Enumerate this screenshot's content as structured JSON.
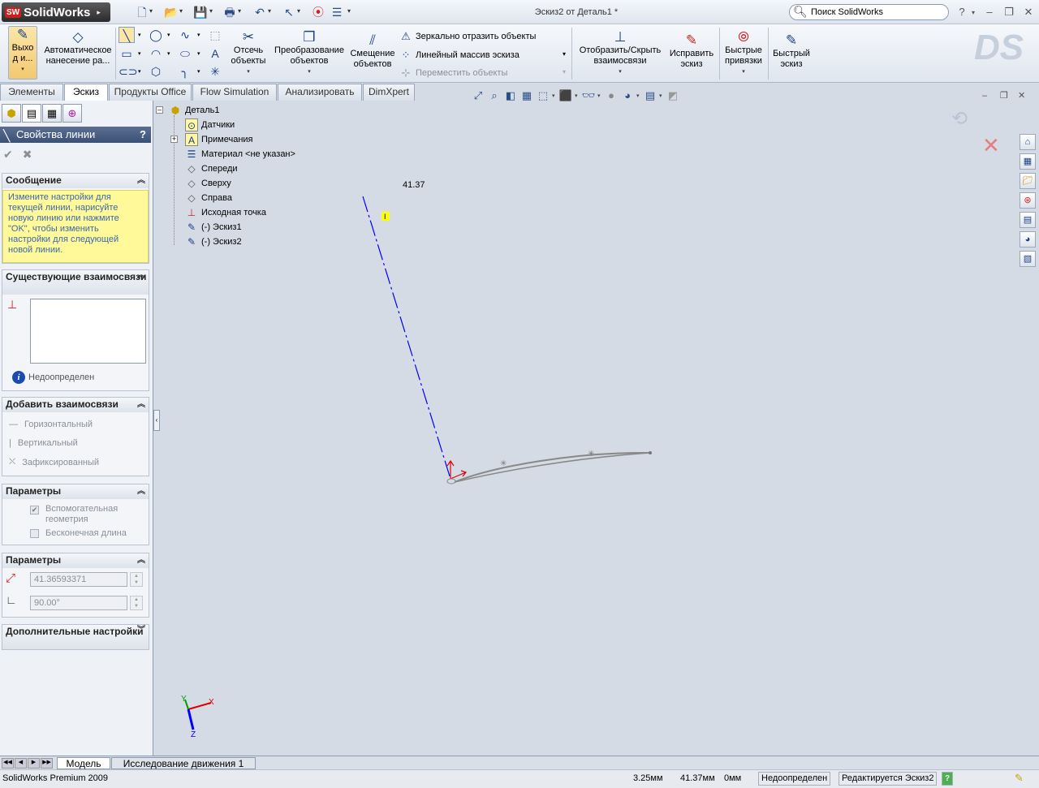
{
  "app": {
    "logo": "SolidWorks",
    "logo_badge": "SW",
    "window_title": "Эскиз2 от Деталь1 *",
    "search_placeholder": "Поиск SolidWorks"
  },
  "ribbon": {
    "exit_sketch": "Выхо\nд и...",
    "auto_dimension": "Автоматическое\nнанесение ра...",
    "trim": "Отсечь\nобъекты",
    "convert": "Преобразование\nобъектов",
    "offset": "Смещение\nобъектов",
    "mirror": "Зеркально отразить объекты",
    "linear_pattern": "Линейный массив эскиза",
    "move": "Переместить объекты",
    "show_hide_relations": "Отобразить/Скрыть\nвзаимосвязи",
    "repair_sketch": "Исправить\nэскиз",
    "quick_snaps": "Быстрые\nпривязки",
    "rapid_sketch": "Быстрый\nэскиз"
  },
  "tabs": [
    "Элементы",
    "Эскиз",
    "Продукты Office",
    "Flow Simulation",
    "Анализировать",
    "DimXpert"
  ],
  "active_tab": "Эскиз",
  "property_manager": {
    "title": "Свойства линии",
    "help": "?",
    "message_header": "Сообщение",
    "message": "Измените настройки для текущей линии, нарисуйте новую линию или нажмите \"OK\", чтобы изменить настройки для следующей новой линии.",
    "existing_relations_header": "Существующие взаимосвязи",
    "status": "Недоопределен",
    "add_relations_header": "Добавить взаимосвязи",
    "rel_horizontal": "Горизонтальный",
    "rel_vertical": "Вертикальный",
    "rel_fixed": "Зафиксированный",
    "options_header": "Параметры",
    "construction": "Вспомогательная геометрия",
    "infinite_length": "Бесконечная длина",
    "params_header": "Параметры",
    "length_value": "41.36593371",
    "angle_value": "90.00°",
    "additional_header": "Дополнительные настройки"
  },
  "tree": {
    "root": "Деталь1",
    "items": [
      {
        "label": "Датчики",
        "icon": "sensor-icon"
      },
      {
        "label": "Примечания",
        "icon": "annotation-icon"
      },
      {
        "label": "Материал <не указан>",
        "icon": "material-icon"
      },
      {
        "label": "Спереди",
        "icon": "plane-icon"
      },
      {
        "label": "Сверху",
        "icon": "plane-icon"
      },
      {
        "label": "Справа",
        "icon": "plane-icon"
      },
      {
        "label": "Исходная точка",
        "icon": "origin-icon"
      },
      {
        "label": "(-) Эскиз1",
        "icon": "sketch-icon"
      },
      {
        "label": "(-) Эскиз2",
        "icon": "sketch-icon"
      }
    ]
  },
  "graphics": {
    "dimension_text": "41.37",
    "cursor_badge": "I",
    "triad_x": "X",
    "triad_y": "Y",
    "triad_z": "Z"
  },
  "bottom_tabs": [
    "Модель",
    "Исследование движения 1"
  ],
  "statusbar": {
    "product": "SolidWorks Premium 2009",
    "x": "3.25мм",
    "y": "41.37мм",
    "z": "0мм",
    "state": "Недоопределен",
    "editing": "Редактируется Эскиз2",
    "help": "?"
  },
  "colors": {
    "sketch_line": "#0000ff",
    "curve": "#888888",
    "background": "#d4dbe5",
    "message_bg": "#fff99a"
  }
}
